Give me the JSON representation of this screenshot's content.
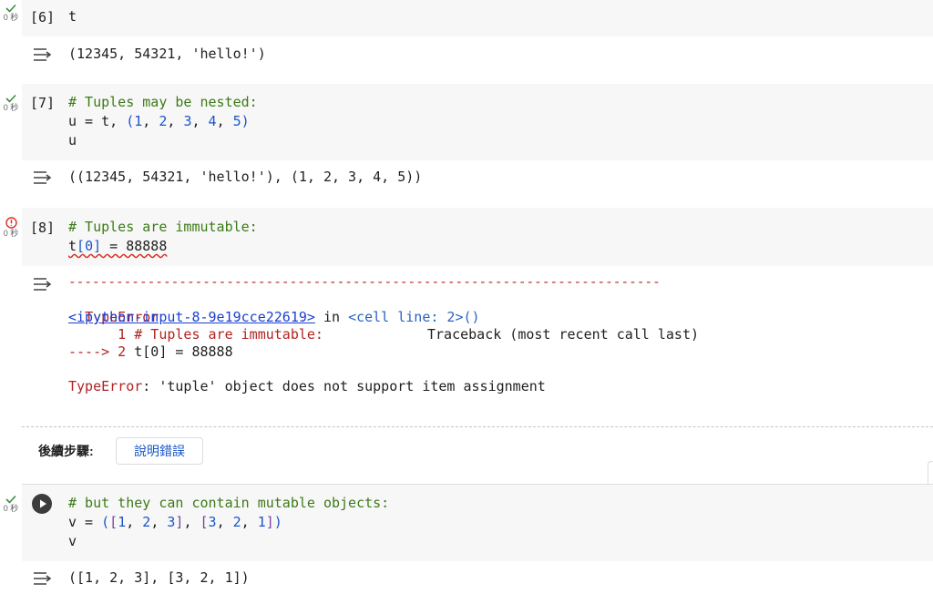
{
  "colors": {
    "comment": "#3c7a18",
    "number": "#1a56c8",
    "error": "#b22222",
    "success": "#3c8d3c"
  },
  "cells": [
    {
      "count": "[6]",
      "duration": "0 秒",
      "status_icon": "check-icon",
      "code": [
        "t"
      ],
      "output": [
        "(12345, 54321, 'hello!')"
      ]
    },
    {
      "count": "[7]",
      "duration": "0 秒",
      "status_icon": "check-icon",
      "code": [
        "# Tuples may be nested:",
        "u = t, (1, 2, 3, 4, 5)",
        "u"
      ],
      "output": [
        "((12345, 54321, 'hello!'), (1, 2, 3, 4, 5))"
      ]
    },
    {
      "count": "[8]",
      "duration": "0 秒",
      "status_icon": "error-icon",
      "code": [
        "# Tuples are immutable:",
        "t[0] = 88888"
      ],
      "traceback": {
        "rule": "---------------------------------------------------------------------------",
        "error_type": "TypeError",
        "header_right": "Traceback (most recent call last)",
        "file_link": "<ipython-input-8-9e19cce22619>",
        "in_text": " in ",
        "cell_link": "<cell line: 2>()",
        "line1": "      1 # Tuples are immutable:",
        "arrow": "----> 2 ",
        "line2_code": "t[0] = 88888",
        "final_type": "TypeError",
        "final_msg": ": 'tuple' object does not support item assignment"
      }
    },
    {
      "duration": "0 秒",
      "status_icon": "check-icon",
      "code": [
        "# but they can contain mutable objects:",
        "v = ([1, 2, 3], [3, 2, 1])",
        "v"
      ],
      "output": [
        "([1, 2, 3], [3, 2, 1])"
      ]
    }
  ],
  "next_steps": {
    "label": "後續步驟:",
    "explain_button": "說明錯誤"
  }
}
